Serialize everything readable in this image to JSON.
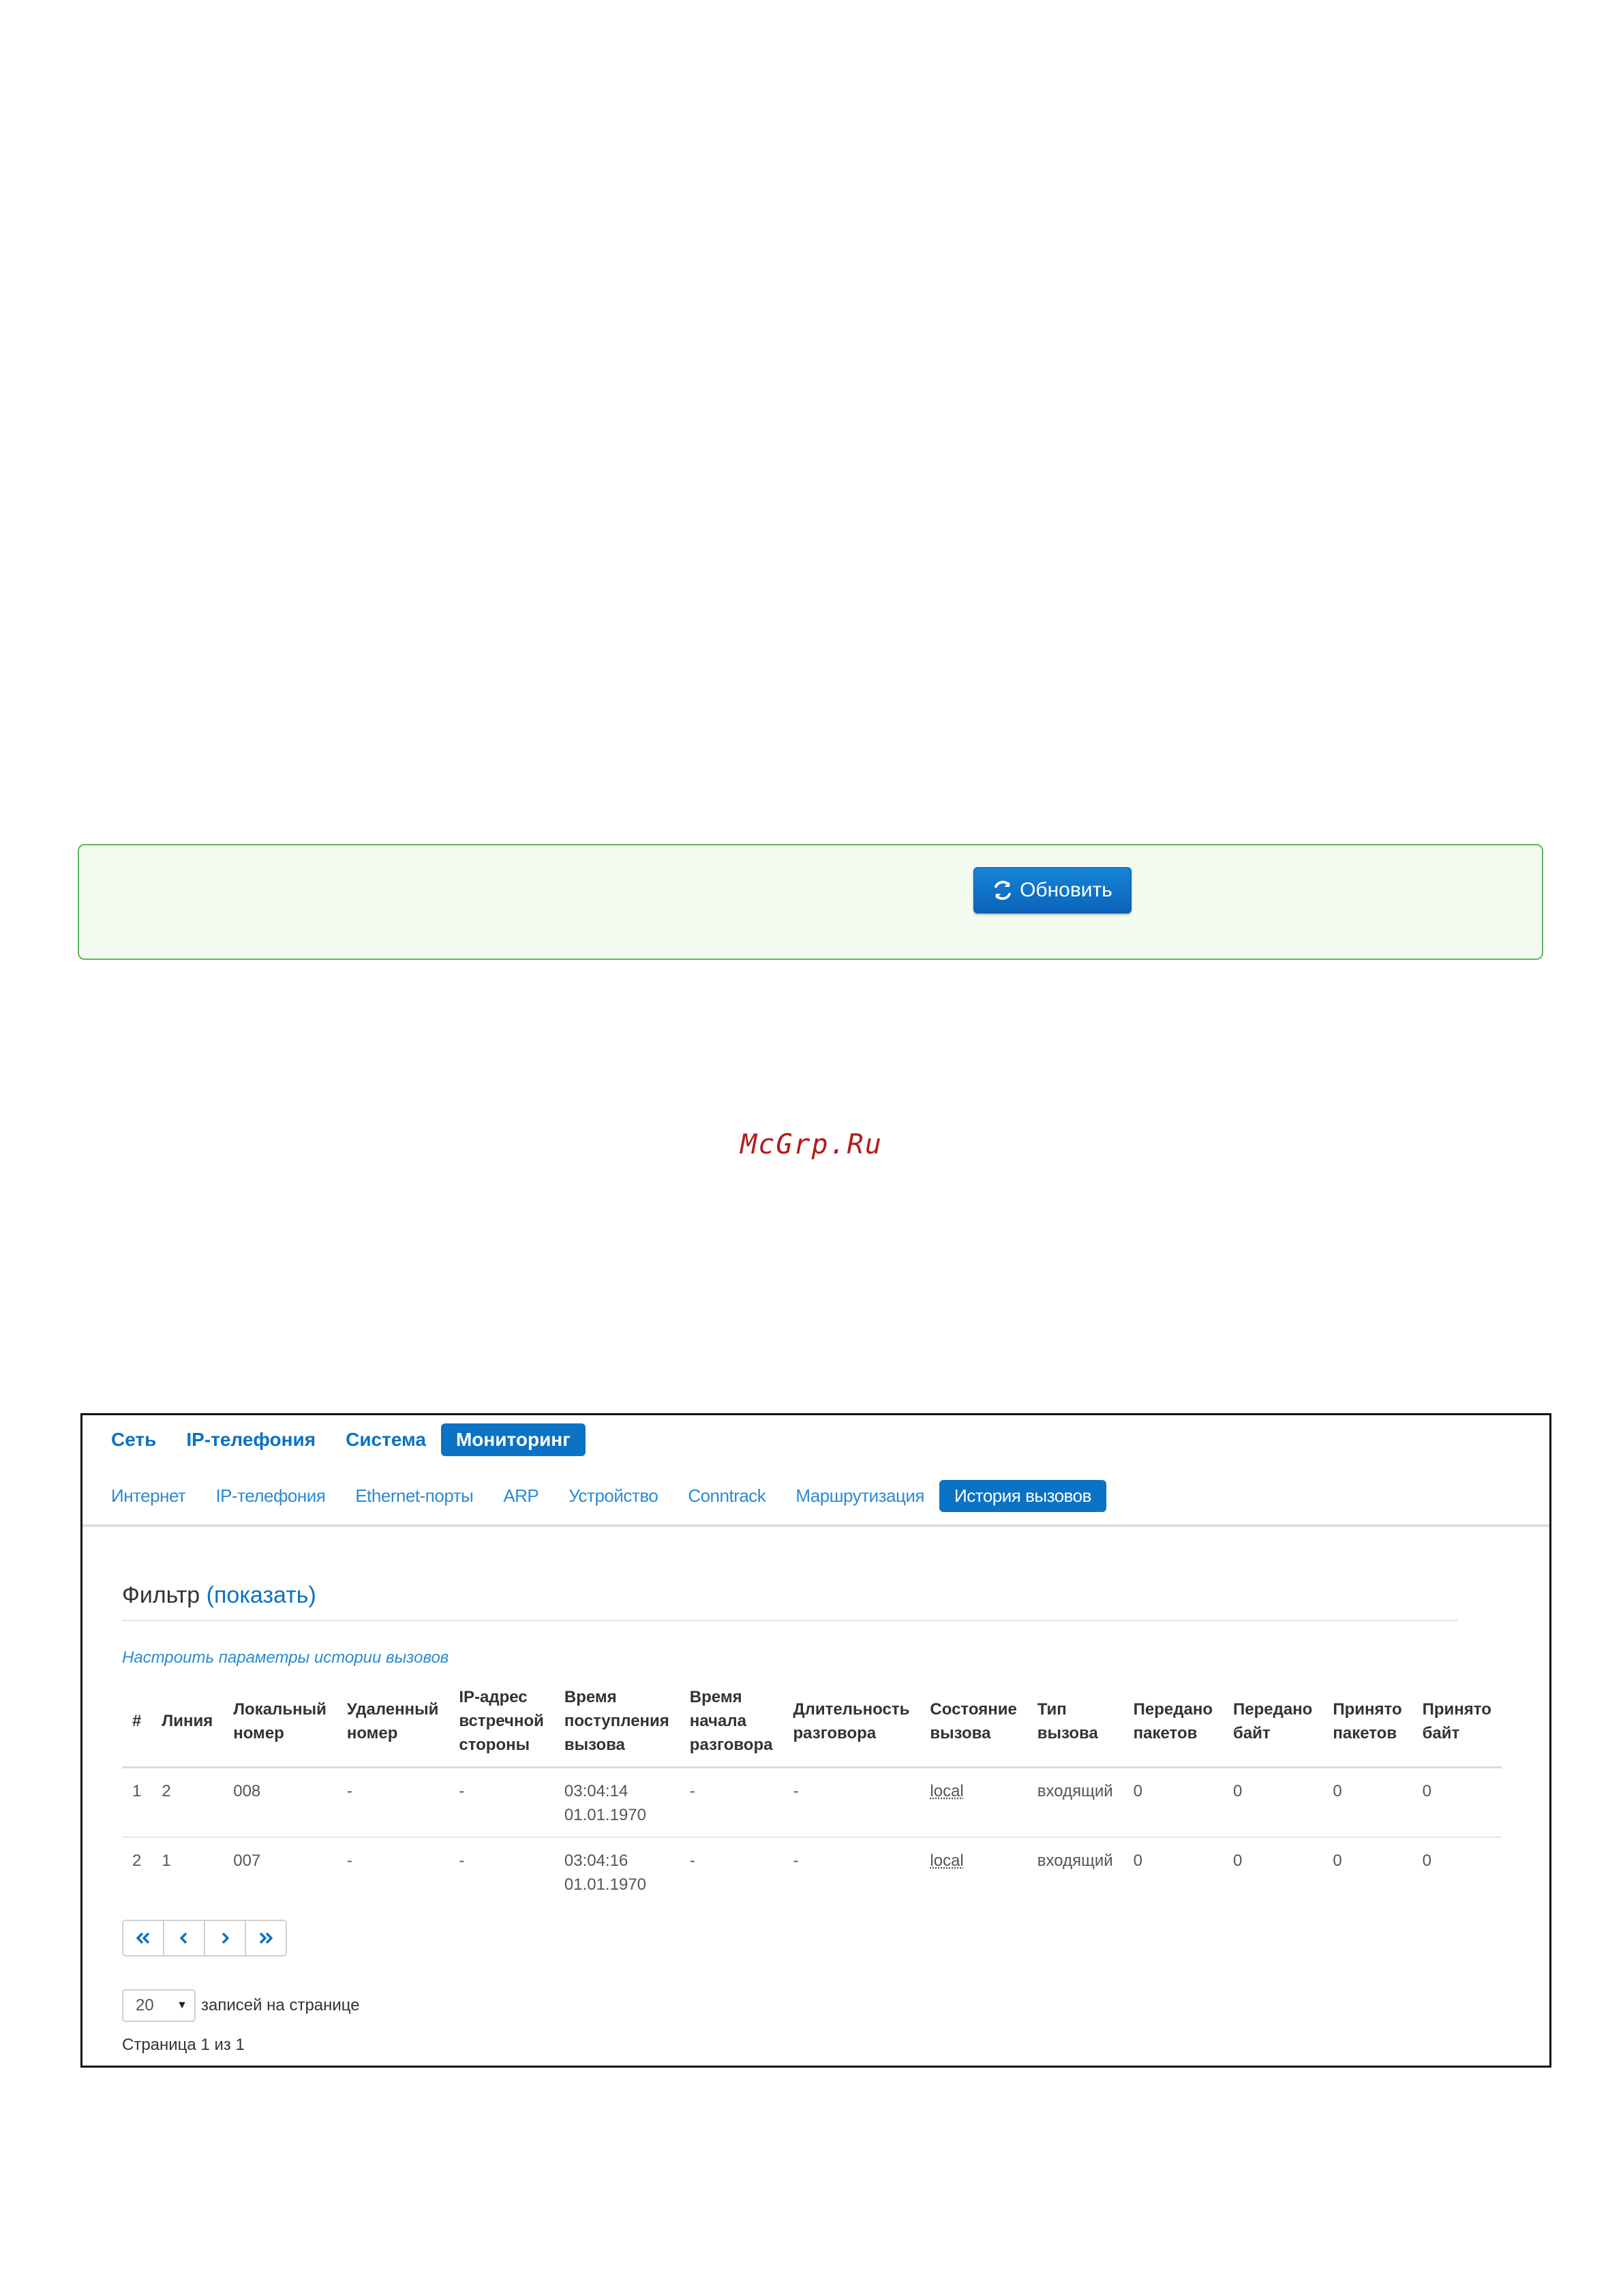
{
  "refresh": {
    "label": "Обновить"
  },
  "watermark": "McGrp.Ru",
  "nav_main": [
    {
      "label": "Сеть",
      "active": false
    },
    {
      "label": "IP-телефония",
      "active": false
    },
    {
      "label": "Система",
      "active": false
    },
    {
      "label": "Мониторинг",
      "active": true
    }
  ],
  "nav_sub": [
    {
      "label": "Интернет",
      "active": false
    },
    {
      "label": "IP-телефония",
      "active": false
    },
    {
      "label": "Ethernet-порты",
      "active": false
    },
    {
      "label": "ARP",
      "active": false
    },
    {
      "label": "Устройство",
      "active": false
    },
    {
      "label": "Conntrack",
      "active": false
    },
    {
      "label": "Маршрутизация",
      "active": false
    },
    {
      "label": "История вызовов",
      "active": true
    }
  ],
  "filter": {
    "title": "Фильтр",
    "toggle": "(показать)"
  },
  "settings_link": "Настроить параметры истории вызовов",
  "table": {
    "headers": [
      [
        "#"
      ],
      [
        "Линия"
      ],
      [
        "Локальный",
        "номер"
      ],
      [
        "Удаленный",
        "номер"
      ],
      [
        "IP-адрес",
        "встречной",
        "стороны"
      ],
      [
        "Время",
        "поступления",
        "вызова"
      ],
      [
        "Время",
        "начала",
        "разговора"
      ],
      [
        "Длительность",
        "разговора"
      ],
      [
        "Состояние",
        "вызова"
      ],
      [
        "Тип",
        "вызова"
      ],
      [
        "Передано",
        "пакетов"
      ],
      [
        "Передано",
        "байт"
      ],
      [
        "Принято",
        "пакетов"
      ],
      [
        "Принято",
        "байт"
      ]
    ],
    "rows": [
      [
        "1",
        "2",
        "008",
        "-",
        "-",
        [
          "03:04:14",
          "01.01.1970"
        ],
        "-",
        "-",
        "local",
        "входящий",
        "0",
        "0",
        "0",
        "0"
      ],
      [
        "2",
        "1",
        "007",
        "-",
        "-",
        [
          "03:04:16",
          "01.01.1970"
        ],
        "-",
        "-",
        "local",
        "входящий",
        "0",
        "0",
        "0",
        "0"
      ]
    ]
  },
  "pager": {
    "first": "first-page-icon",
    "prev": "prev-page-icon",
    "next": "next-page-icon",
    "last": "last-page-icon"
  },
  "per_page": {
    "value": "20",
    "label": "записей на странице"
  },
  "page_info": "Страница 1 из 1",
  "colors": {
    "accent": "#0b72c4",
    "panel_border": "#5cb85c"
  }
}
